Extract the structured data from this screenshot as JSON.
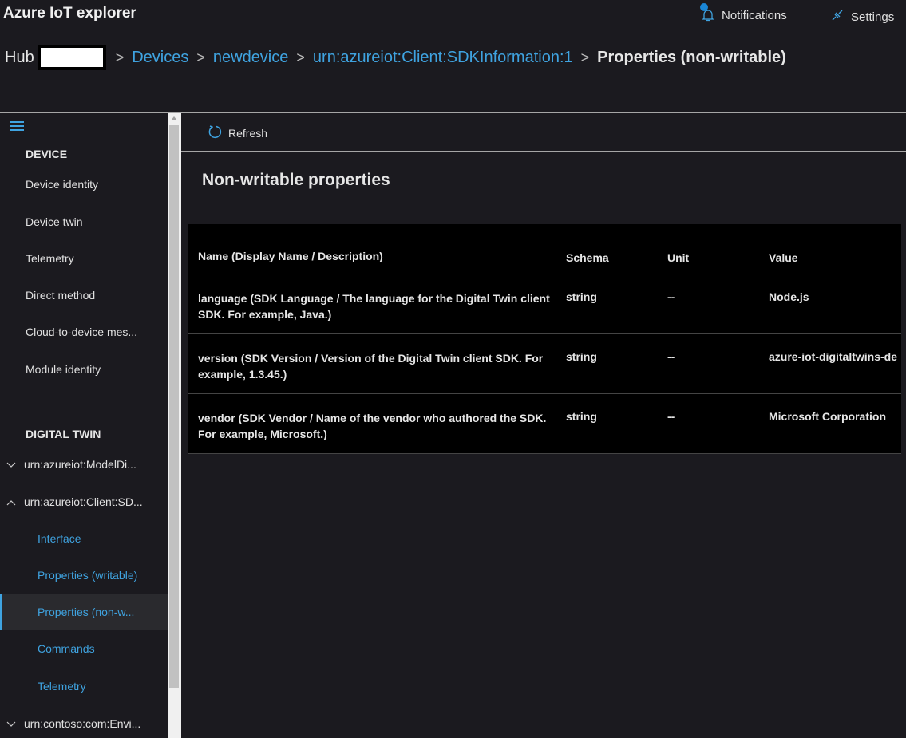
{
  "app": {
    "title": "Azure IoT explorer"
  },
  "header": {
    "notifications_label": "Notifications",
    "settings_label": "Settings"
  },
  "breadcrumb": [
    {
      "label": "Hub"
    },
    {
      "label": "Devices"
    },
    {
      "label": "newdevice"
    },
    {
      "label": "urn:azureiot:Client:SDKInformation:1"
    },
    {
      "label": "Properties (non-writable)"
    }
  ],
  "sidebar": {
    "device_heading": "DEVICE",
    "device_items": [
      "Device identity",
      "Device twin",
      "Telemetry",
      "Direct method",
      "Cloud-to-device mes...",
      "Module identity"
    ],
    "digital_twin_heading": "DIGITAL TWIN",
    "tree": [
      {
        "label": "urn:azureiot:ModelDi...",
        "expanded": false
      },
      {
        "label": "urn:azureiot:Client:SD...",
        "expanded": true
      },
      {
        "label": "urn:contoso:com:Envi...",
        "expanded": false
      }
    ],
    "sub_items": [
      "Interface",
      "Properties (writable)",
      "Properties (non-w...",
      "Commands",
      "Telemetry"
    ],
    "selected": "Properties (non-w..."
  },
  "toolbar": {
    "refresh_label": "Refresh"
  },
  "main": {
    "title": "Non-writable properties",
    "columns": [
      "Name (Display Name / Description)",
      "Schema",
      "Unit",
      "Value"
    ],
    "rows": [
      {
        "name": "language (SDK Language / The language for the Digital Twin client SDK. For example, Java.)",
        "schema": "string",
        "unit": "--",
        "value": "Node.js"
      },
      {
        "name": "version (SDK Version / Version of the Digital Twin client SDK. For example, 1.3.45.)",
        "schema": "string",
        "unit": "--",
        "value": "azure-iot-digitaltwins-de"
      },
      {
        "name": "vendor (SDK Vendor / Name of the vendor who authored the SDK. For example, Microsoft.)",
        "schema": "string",
        "unit": "--",
        "value": "Microsoft Corporation"
      }
    ]
  }
}
